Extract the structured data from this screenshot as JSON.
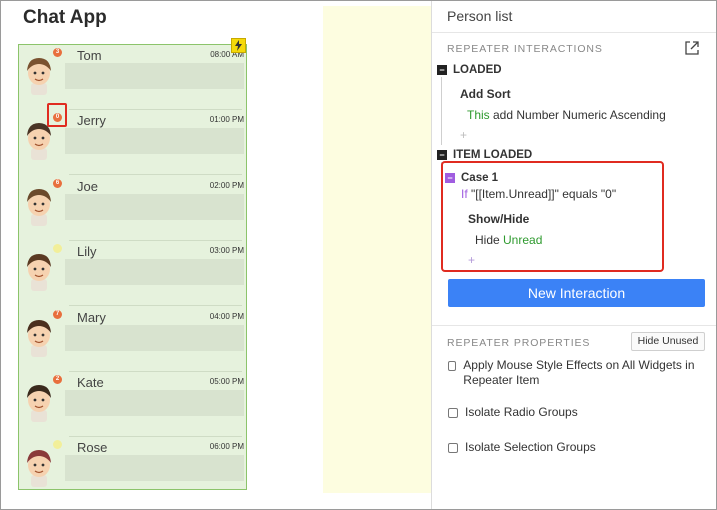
{
  "app": {
    "title": "Chat App"
  },
  "contacts": [
    {
      "name": "Tom",
      "time": "08:00 AM",
      "unread": "3"
    },
    {
      "name": "Jerry",
      "time": "01:00 PM",
      "unread": "0"
    },
    {
      "name": "Joe",
      "time": "02:00 PM",
      "unread": "6"
    },
    {
      "name": "Lily",
      "time": "03:00 PM",
      "unread": ""
    },
    {
      "name": "Mary",
      "time": "04:00 PM",
      "unread": "7"
    },
    {
      "name": "Kate",
      "time": "05:00 PM",
      "unread": "2"
    },
    {
      "name": "Rose",
      "time": "06:00 PM",
      "unread": ""
    }
  ],
  "panel": {
    "title": "Person list",
    "interactions_label": "REPEATER INTERACTIONS",
    "events": {
      "loaded": {
        "label": "LOADED",
        "action_title": "Add Sort",
        "action_target": "This",
        "action_text": " add Number Numeric Ascending"
      },
      "item_loaded": {
        "label": "ITEM LOADED",
        "case_title": "Case 1",
        "case_if": "If",
        "case_condition": " \"[[Item.Unread]]\" equals \"0\"",
        "action_title": "Show/Hide",
        "action_verb": "Hide ",
        "action_target": "Unread"
      }
    },
    "new_interaction_label": "New Interaction",
    "properties_label": "REPEATER PROPERTIES",
    "hide_unused_label": "Hide Unused",
    "checkboxes": [
      {
        "label": "Apply Mouse Style Effects on All Widgets in Repeater Item",
        "checked": false
      },
      {
        "label": "Isolate Radio Groups",
        "checked": false
      },
      {
        "label": "Isolate Selection Groups",
        "checked": false
      }
    ]
  },
  "colors": {
    "accent": "#3b82f6",
    "highlight": "#e02b20",
    "badge": "#e86f3d",
    "repeater_border": "#8cc46b",
    "green_text": "#2e9a2e",
    "purple": "#a05de0"
  },
  "icons": [
    "lightning-icon",
    "popout-icon",
    "collapse-icon",
    "plus-icon",
    "checkbox-icon"
  ]
}
